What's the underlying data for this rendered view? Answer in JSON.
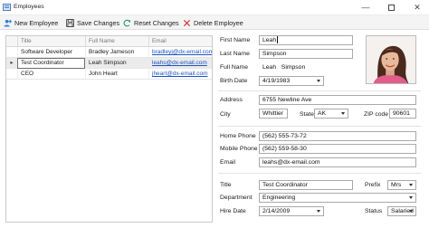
{
  "window": {
    "title": "Employees"
  },
  "toolbar": {
    "new_employee": "New Employee",
    "save_changes": "Save Changes",
    "reset_changes": "Reset Changes",
    "delete_employee": "Delete Employee"
  },
  "grid": {
    "columns": [
      "Title",
      "Full Name",
      "Email"
    ],
    "rows": [
      {
        "indicator": "",
        "title": "Software Developer",
        "full_name": "Bradley Jameson",
        "email": "bradleyj@dx-email.com"
      },
      {
        "indicator": "▸",
        "title": "Test Coordinator",
        "full_name": "Leah Simpson",
        "email": "leahs@dx-email.com"
      },
      {
        "indicator": "",
        "title": "CEO",
        "full_name": "John Heart",
        "email": "jheart@dx-email.com"
      }
    ]
  },
  "form": {
    "first_name_label": "First Name",
    "first_name": "Leah",
    "last_name_label": "Last Name",
    "last_name": "Simpson",
    "full_name_label": "Full Name",
    "full_name": "Leah   Simpson",
    "birth_date_label": "Birth Date",
    "birth_date": "4/19/1983",
    "address_label": "Address",
    "address": "6755 Newline Ave",
    "city_label": "City",
    "city": "Whittier",
    "state_label": "State",
    "state": "AK",
    "zip_label": "ZIP code",
    "zip": "90601",
    "home_phone_label": "Home Phone",
    "home_phone": "(562) 555-73-72",
    "mobile_phone_label": "Mobile Phone",
    "mobile_phone": "(562) 559-58-30",
    "email_label": "Email",
    "email": "leahs@dx-email.com",
    "title_label": "Title",
    "title": "Test Coordinator",
    "prefix_label": "Prefix",
    "prefix": "Mrs",
    "department_label": "Department",
    "department": "Engineering",
    "hire_date_label": "Hire Date",
    "hire_date": "2/14/2009",
    "status_label": "Status",
    "status": "Salaried"
  },
  "colors": {
    "link": "#1a56c4",
    "selected_row": "#ebebeb",
    "new_icon": "#2e7fd6",
    "save_icon": "#3a3a3a",
    "reset_icon": "#2f9a63",
    "delete_icon": "#d03b3b"
  },
  "icons": {
    "new": "person-add-icon",
    "save": "floppy-disk-icon",
    "reset": "refresh-icon",
    "delete": "close-x-icon",
    "photo": "employee-photo"
  }
}
